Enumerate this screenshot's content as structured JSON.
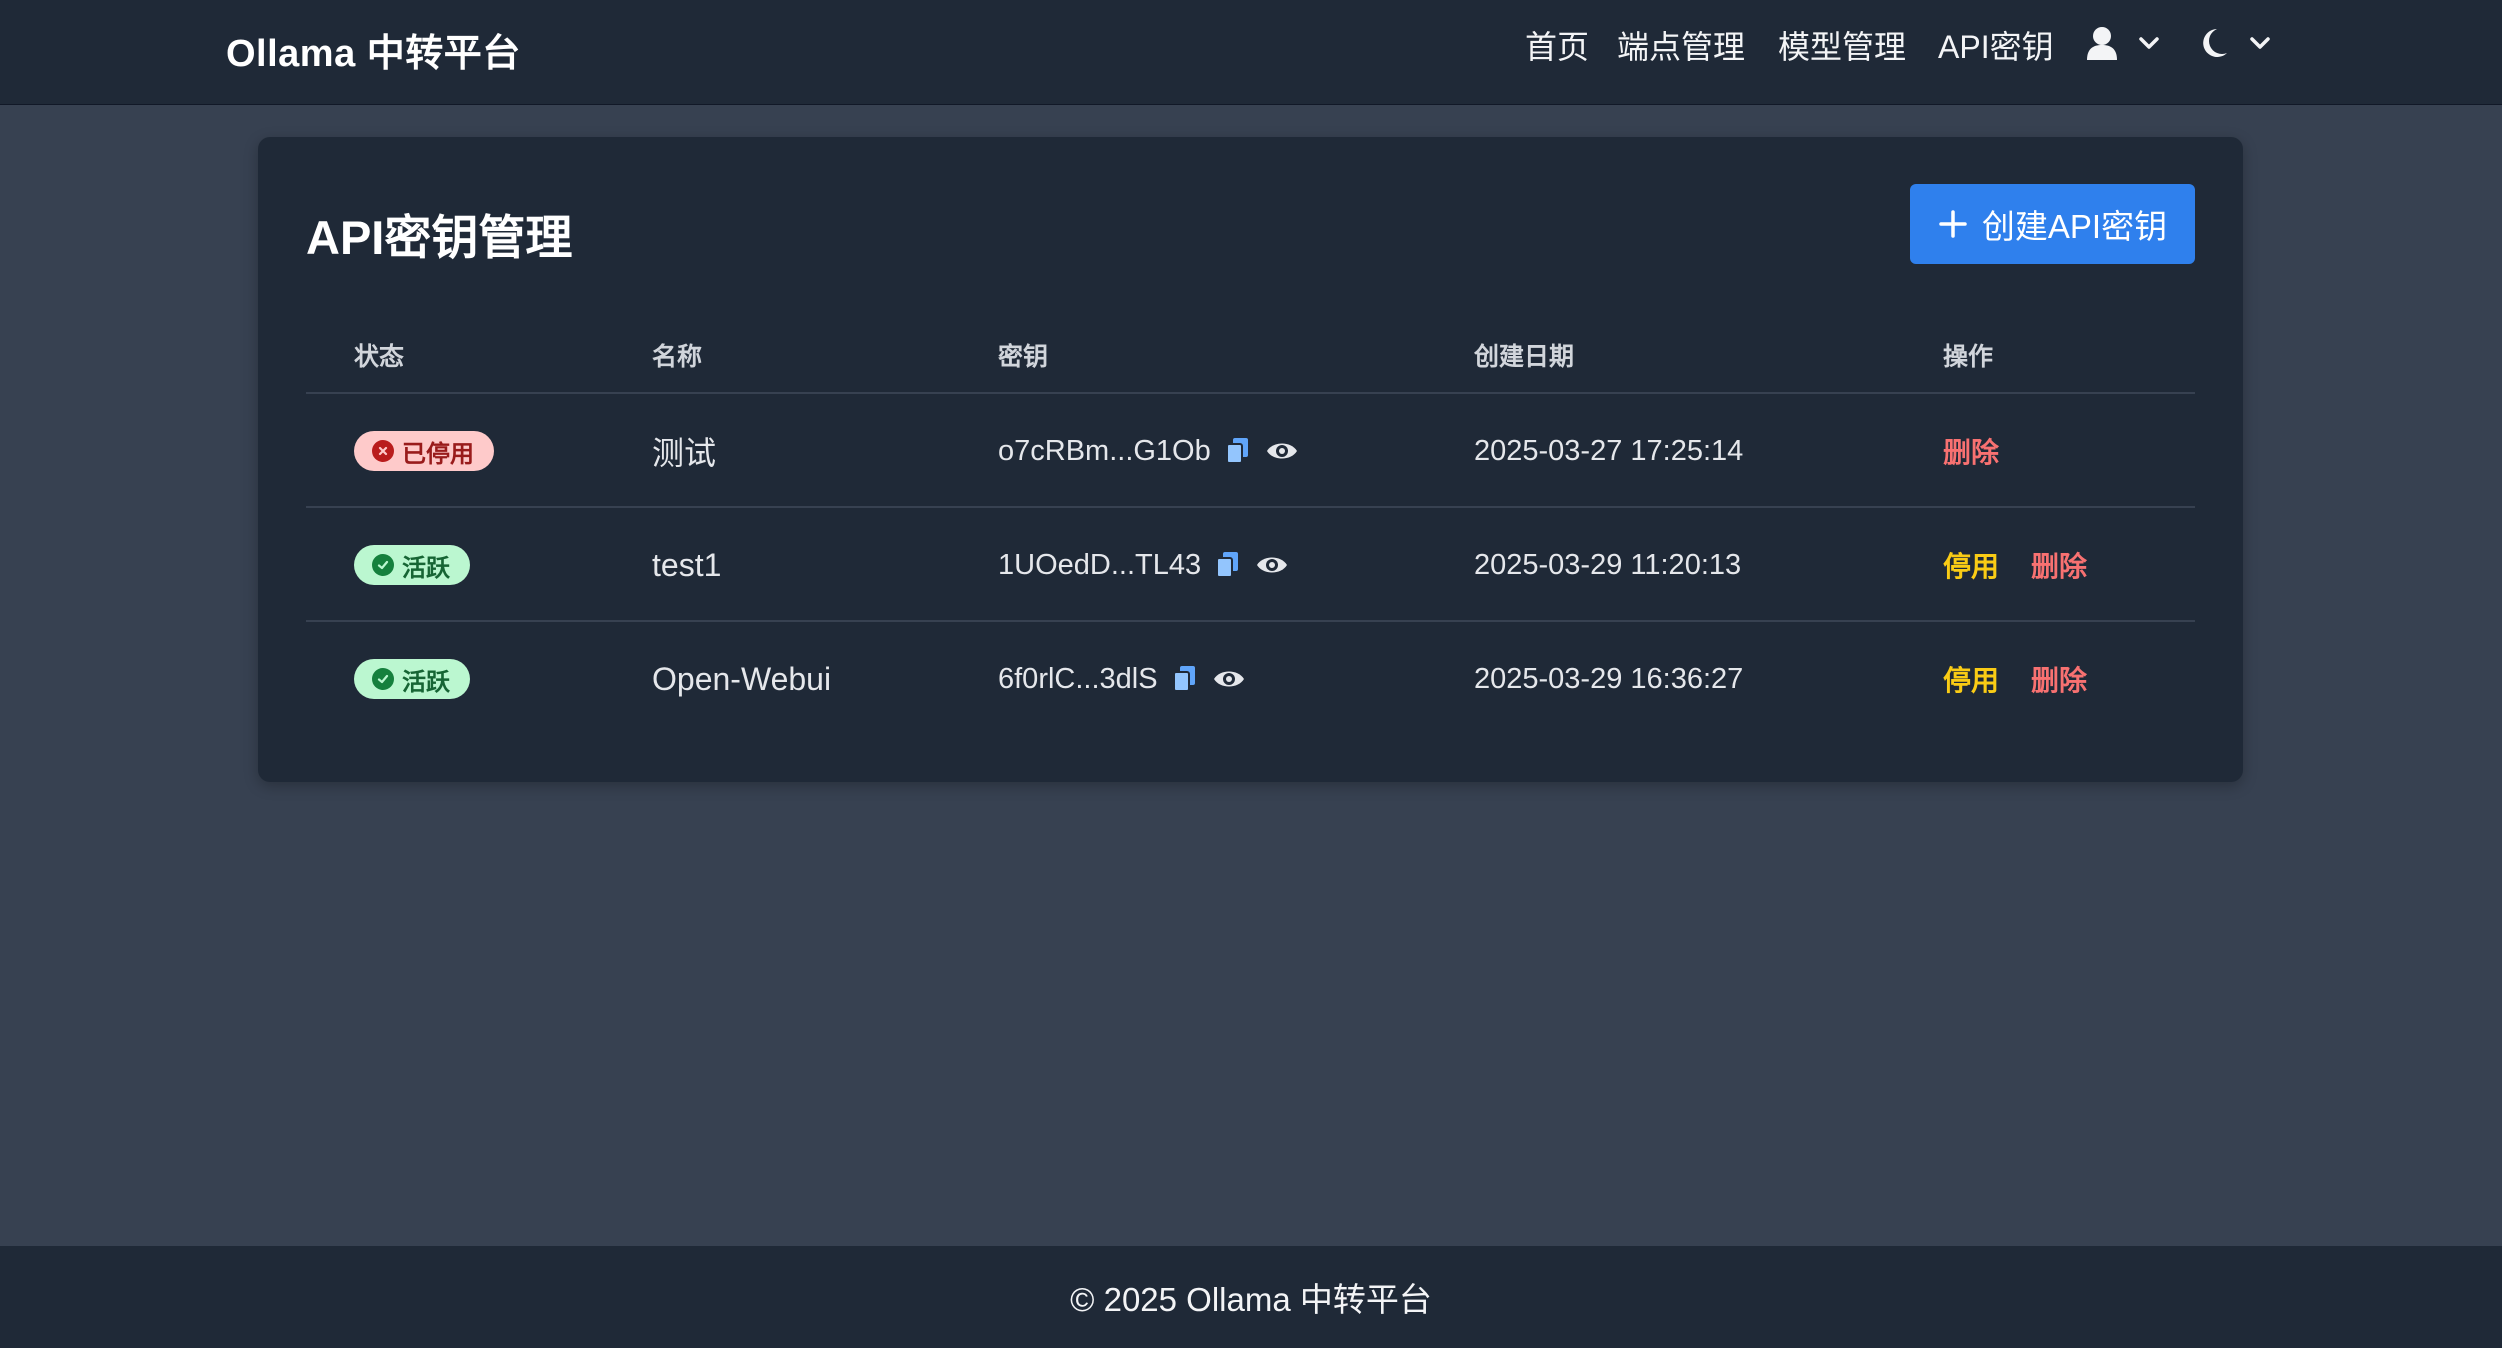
{
  "navbar": {
    "brand": "Ollama 中转平台",
    "links": [
      "首页",
      "端点管理",
      "模型管理",
      "API密钥"
    ],
    "user_icon": "user-icon",
    "theme_icon": "moon-icon"
  },
  "page": {
    "title": "API密钥管理",
    "create_button": "创建API密钥"
  },
  "table": {
    "headers": [
      "状态",
      "名称",
      "密钥",
      "创建日期",
      "操作"
    ],
    "rows": [
      {
        "status": "已停用",
        "status_type": "disabled",
        "name": "测试",
        "key": "o7cRBm...G1Ob",
        "created": "2025-03-27 17:25:14",
        "actions": [
          "删除"
        ]
      },
      {
        "status": "活跃",
        "status_type": "active",
        "name": "test1",
        "key": "1UOedD...TL43",
        "created": "2025-03-29 11:20:13",
        "actions": [
          "停用",
          "删除"
        ]
      },
      {
        "status": "活跃",
        "status_type": "active",
        "name": "Open-Webui",
        "key": "6f0rlC...3dlS",
        "created": "2025-03-29 16:36:27",
        "actions": [
          "停用",
          "删除"
        ]
      }
    ]
  },
  "footer": {
    "text": "© 2025 Ollama 中转平台"
  },
  "colors": {
    "primary": "#2f80ed",
    "nav_bg": "#1f2937",
    "page_bg": "#374151",
    "warning": "#facc15",
    "danger": "#f87171"
  }
}
